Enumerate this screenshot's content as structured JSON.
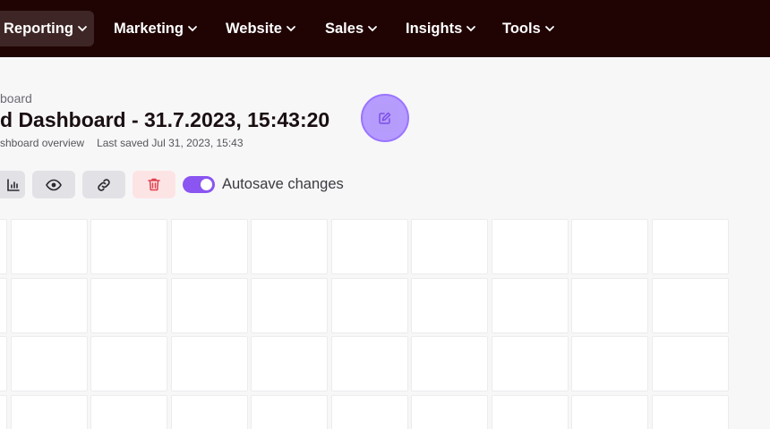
{
  "nav": {
    "items": [
      {
        "label": "Reporting",
        "active": true
      },
      {
        "label": "Marketing",
        "active": false
      },
      {
        "label": "Website",
        "active": false
      },
      {
        "label": "Sales",
        "active": false
      },
      {
        "label": "Insights",
        "active": false
      },
      {
        "label": "Tools",
        "active": false
      }
    ]
  },
  "header": {
    "breadcrumb": "board",
    "title": "d Dashboard - 31.7.2023, 15:43:20",
    "subtitle": "shboard overview",
    "last_saved": "Last saved Jul 31, 2023, 15:43"
  },
  "toolbar": {
    "buttons": [
      {
        "icon": "bar-chart-icon",
        "name": "chart-button"
      },
      {
        "icon": "eye-icon",
        "name": "preview-button"
      },
      {
        "icon": "link-icon",
        "name": "copy-link-button"
      },
      {
        "icon": "trash-icon",
        "name": "delete-button"
      }
    ],
    "autosave_label": "Autosave changes",
    "autosave_on": true
  },
  "colors": {
    "nav_bg": "#200303",
    "accent": "#8a55f0",
    "danger": "#e0404f"
  },
  "grid": {
    "columns": 10,
    "rows": 4
  }
}
